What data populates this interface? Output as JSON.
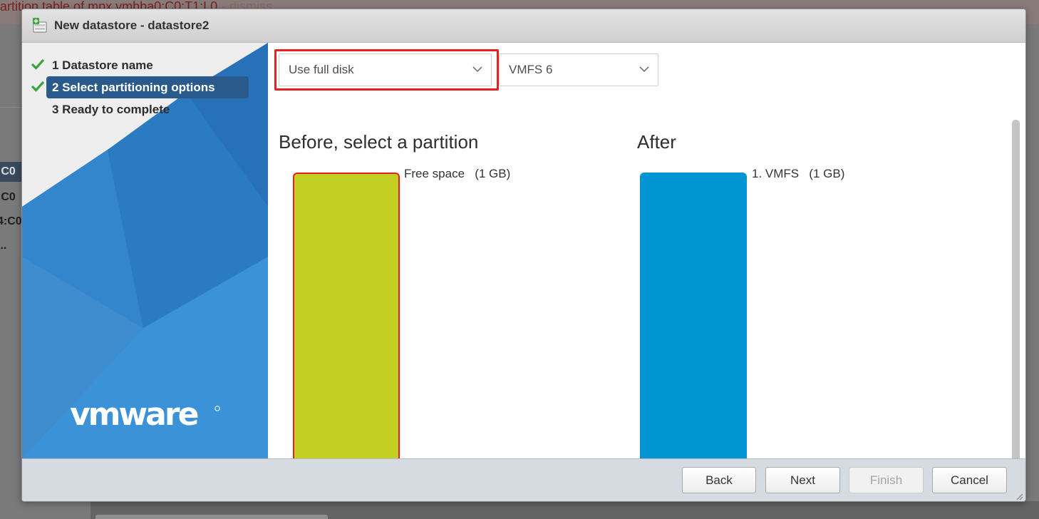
{
  "background": {
    "banner_text": "artition table of mpx.vmhba0:C0:T1:L0",
    "banner_dismiss": "- dismiss",
    "rows": [
      ":C0",
      ":C0",
      "4:C0",
      "..."
    ]
  },
  "dialog": {
    "title": "New datastore - datastore2"
  },
  "wizard": {
    "steps": [
      {
        "label": "1 Datastore name",
        "done": true
      },
      {
        "label": "2 Select partitioning options",
        "done": true,
        "active": true
      },
      {
        "label": "3 Ready to complete",
        "done": false
      }
    ],
    "logo_text": "vmware"
  },
  "options": {
    "partition_mode": {
      "value": "Use full disk"
    },
    "fs_version": {
      "value": "VMFS 6"
    }
  },
  "before": {
    "title": "Before, select a partition",
    "partition_label": "Free space   (1 GB)"
  },
  "after": {
    "title": "After",
    "partition_label": "1. VMFS   (1 GB)"
  },
  "footer": {
    "back": "Back",
    "next": "Next",
    "finish": "Finish",
    "cancel": "Cancel"
  },
  "colors": {
    "before_bar": "#c3cf23",
    "after_bar": "#0196d3",
    "highlight": "#e8211f",
    "active_step": "#2a5a8c"
  }
}
